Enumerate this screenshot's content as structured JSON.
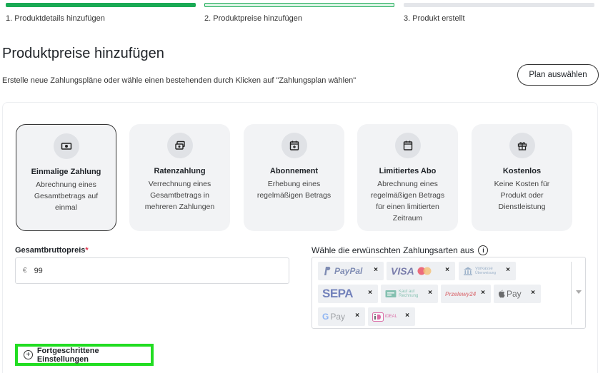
{
  "steps": [
    {
      "label": "1. Produktdetails hinzufügen"
    },
    {
      "label": "2. Produktpreise hinzufügen"
    },
    {
      "label": "3. Produkt erstellt"
    }
  ],
  "page": {
    "title": "Produktpreise hinzufügen",
    "subtitle": "Erstelle neue Zahlungspläne oder wähle einen bestehenden durch Klicken auf \"Zahlungsplan wählen\"",
    "plan_button": "Plan auswählen"
  },
  "cards": [
    {
      "title": "Einmalige Zahlung",
      "desc": "Abrechnung eines Gesamtbetrags auf einmal",
      "icon": "banknote-icon",
      "selected": true
    },
    {
      "title": "Ratenzahlung",
      "desc": "Verrechnung eines Gesamtbetrags in mehreren Zahlungen",
      "icon": "banknotes-icon",
      "selected": false
    },
    {
      "title": "Abonnement",
      "desc": "Erhebung eines regelmäßigen Betrags",
      "icon": "calendar-plus-icon",
      "selected": false
    },
    {
      "title": "Limitiertes Abo",
      "desc": "Abrechnung eines regelmäßigen Betrags für einen limitierten Zeitraum",
      "icon": "calendar-icon",
      "selected": false
    },
    {
      "title": "Kostenlos",
      "desc": "Keine Kosten für Produkt oder Dienstleistung",
      "icon": "gift-icon",
      "selected": false
    }
  ],
  "price": {
    "label": "Gesamtbruttopreis",
    "required_mark": "*",
    "currency": "€",
    "value": "99"
  },
  "payment": {
    "label": "Wähle die erwünschten Zahlungsarten aus",
    "info_symbol": "i",
    "remove_symbol": "×",
    "methods": [
      {
        "name": "PayPal",
        "icon": "paypal-logo-icon"
      },
      {
        "name": "VISA",
        "icon": "visa-mastercard-logo-icon"
      },
      {
        "name": "Vorkasse",
        "sub": "Überweisung",
        "icon": "bank-icon"
      },
      {
        "name": "SEPA",
        "icon": "sepa-logo-icon"
      },
      {
        "name": "Kauf auf Rechnung",
        "icon": "invoice-icon"
      },
      {
        "name": "Przelewy24",
        "icon": "przelewy24-logo-icon"
      },
      {
        "name": "Pay",
        "icon": "apple-pay-logo-icon"
      },
      {
        "name": "Pay",
        "prefix": "G",
        "icon": "google-pay-logo-icon"
      },
      {
        "name": "iDEAL",
        "icon": "ideal-logo-icon"
      }
    ]
  },
  "advanced": {
    "label": "Fortgeschrittene Einstellungen",
    "icon": "plus-circle-icon"
  },
  "colors": {
    "accent": "#1aaa55",
    "highlight": "#22dd22",
    "required": "#e0314b"
  }
}
